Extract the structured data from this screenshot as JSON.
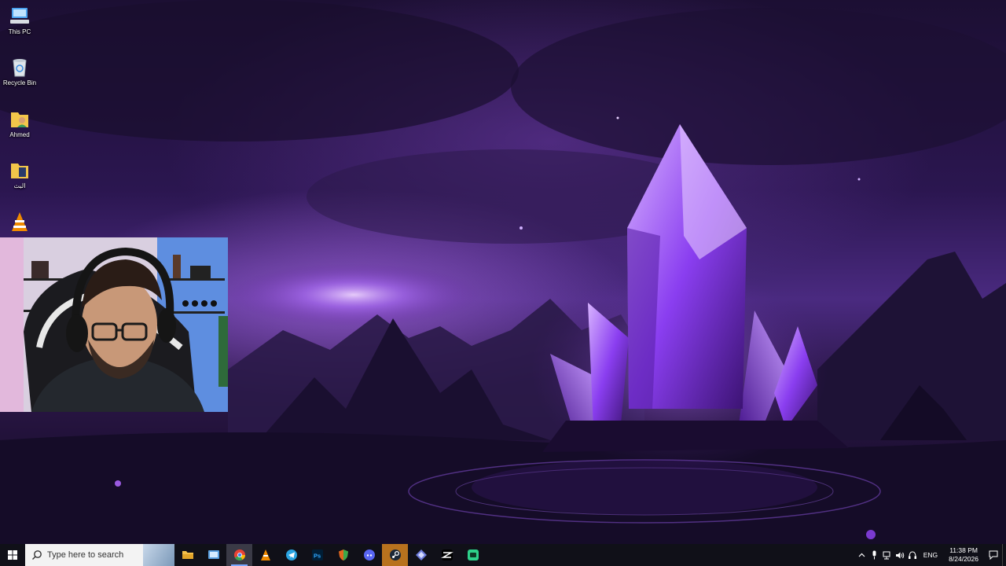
{
  "desktop": {
    "icons": [
      {
        "label": "This PC",
        "icon": "computer-icon"
      },
      {
        "label": "Recycle Bin",
        "icon": "recycle-bin-icon"
      },
      {
        "label": "Ahmed",
        "icon": "user-folder-icon"
      },
      {
        "label": "البث",
        "icon": "folder-icon"
      },
      {
        "label": "",
        "icon": "vlc-icon"
      }
    ]
  },
  "taskbar": {
    "search_placeholder": "Type here to search",
    "apps": [
      {
        "name": "File Explorer",
        "icon": "file-explorer-icon",
        "color": "#f4c04a"
      },
      {
        "name": "Control Panel",
        "icon": "control-panel-icon",
        "color": "#5aa0e0"
      },
      {
        "name": "Google Chrome",
        "icon": "chrome-icon",
        "color": "#e94235"
      },
      {
        "name": "VLC",
        "icon": "vlc-icon",
        "color": "#f08a00"
      },
      {
        "name": "Telegram",
        "icon": "telegram-icon",
        "color": "#2aa3e0"
      },
      {
        "name": "Photoshop",
        "icon": "photoshop-icon",
        "color": "#31a8ff"
      },
      {
        "name": "Shield App",
        "icon": "shield-icon",
        "color": "#e0661e"
      },
      {
        "name": "Discord",
        "icon": "discord-icon",
        "color": "#5865f2"
      },
      {
        "name": "Steam",
        "icon": "steam-icon",
        "color": "#1b2838"
      },
      {
        "name": "Git App",
        "icon": "diamond-app-icon",
        "color": "#6e7ddc"
      },
      {
        "name": "CapCut",
        "icon": "capcut-icon",
        "color": "#ffffff"
      },
      {
        "name": "Green App",
        "icon": "green-app-icon",
        "color": "#2ed18a"
      }
    ],
    "tray": {
      "language": "ENG",
      "time": "11:38 PM",
      "date": "8/24/2026"
    }
  },
  "colors": {
    "accent": "#7aa7ff",
    "taskbar_bg": "#101018",
    "wallpaper_primary": "#4a2a80",
    "crystal": "#a45cff"
  }
}
